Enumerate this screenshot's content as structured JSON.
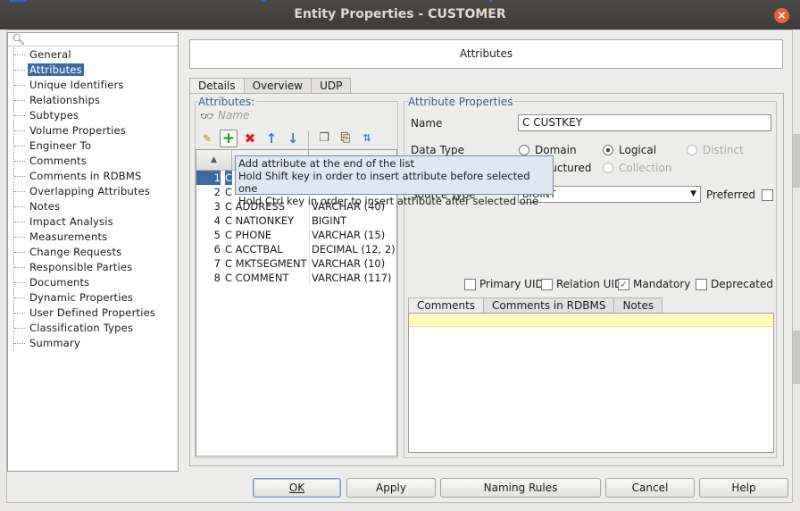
{
  "window": {
    "title": "Entity Properties - CUSTOMER",
    "close_glyph": "×"
  },
  "colors": {
    "selection": "#3d6aa1",
    "group_label": "#3d5f8c",
    "highlight_row": "#fffdb8",
    "add_icon": "#1e9a1e",
    "delete_icon": "#d72020",
    "arrow_icon": "#3a7bd5"
  },
  "nav": {
    "search_placeholder": "",
    "items": [
      {
        "label": "General"
      },
      {
        "label": "Attributes",
        "selected": true
      },
      {
        "label": "Unique Identifiers"
      },
      {
        "label": "Relationships"
      },
      {
        "label": "Subtypes"
      },
      {
        "label": "Volume Properties"
      },
      {
        "label": "Engineer To"
      },
      {
        "label": "Comments"
      },
      {
        "label": "Comments in RDBMS"
      },
      {
        "label": "Overlapping Attributes"
      },
      {
        "label": "Notes"
      },
      {
        "label": "Impact Analysis"
      },
      {
        "label": "Measurements"
      },
      {
        "label": "Change Requests"
      },
      {
        "label": "Responsible Parties"
      },
      {
        "label": "Documents"
      },
      {
        "label": "Dynamic Properties"
      },
      {
        "label": "User Defined Properties"
      },
      {
        "label": "Classification Types"
      },
      {
        "label": "Summary"
      }
    ]
  },
  "header": {
    "title": "Attributes"
  },
  "tabs": [
    "Details",
    "Overview",
    "UDP"
  ],
  "attributes_panel": {
    "label": "Attributes:",
    "filter_placeholder": "Name",
    "toolbar_icons": [
      "brush-icon",
      "add-icon",
      "delete-icon",
      "move-up-icon",
      "move-down-icon",
      "copy-icon",
      "paste-icon",
      "sort-icon"
    ],
    "rows": [
      {
        "num": "1",
        "name": "C",
        "type": ""
      },
      {
        "num": "2",
        "name": "C",
        "type": ""
      },
      {
        "num": "3",
        "name": "C ADDRESS",
        "type": "VARCHAR (40)"
      },
      {
        "num": "4",
        "name": "C NATIONKEY",
        "type": "BIGINT"
      },
      {
        "num": "5",
        "name": "C PHONE",
        "type": "VARCHAR (15)"
      },
      {
        "num": "6",
        "name": "C ACCTBAL",
        "type": "DECIMAL (12, 2)"
      },
      {
        "num": "7",
        "name": "C MKTSEGMENT",
        "type": "VARCHAR (10)"
      },
      {
        "num": "8",
        "name": "C COMMENT",
        "type": "VARCHAR (117)"
      }
    ]
  },
  "tooltip": {
    "line1": "Add attribute at the end of the list",
    "line2": "Hold Shift key in order to insert attribute before selected one",
    "line3": "Hold Ctrl key in order to insert attribute after selected one"
  },
  "properties": {
    "label": "Attribute Properties",
    "name_label": "Name",
    "name_value": "C CUSTKEY",
    "data_type_label": "Data Type",
    "radio_domain": "Domain",
    "radio_logical": "Logical",
    "radio_distinct": "Distinct",
    "radio_structured": "Structured",
    "radio_collection": "Collection",
    "source_type_label": "Source Type",
    "source_type_value": "BIGINT",
    "preferred_label": "Preferred",
    "primary_uid": "Primary UID",
    "relation_uid": "Relation UID",
    "mandatory": "Mandatory",
    "deprecated": "Deprecated"
  },
  "comment_tabs": [
    "Comments",
    "Comments in RDBMS",
    "Notes"
  ],
  "buttons": {
    "ok": "OK",
    "apply": "Apply",
    "naming_rules": "Naming Rules",
    "cancel": "Cancel",
    "help": "Help"
  }
}
